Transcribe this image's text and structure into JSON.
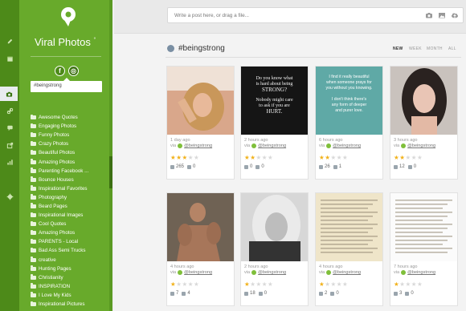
{
  "rail": {
    "icons": [
      "pencil-icon",
      "calendar-icon",
      "chat-icon",
      "camera-icon",
      "link-icon",
      "export-icon",
      "bar-chart-icon",
      "gear-icon"
    ],
    "active_index": 3
  },
  "sidebar": {
    "title": "Viral Photos",
    "title_mark": "°",
    "social": {
      "facebook": "f",
      "instagram": "◎"
    },
    "tag_filter": "#beingstrong",
    "items": [
      "Awesome Quotes",
      "Engaging Photos",
      "Funny Photos",
      "Crazy Photos",
      "Beautiful Photos",
      "Amazing Photos",
      "Parenting Facebook ...",
      "Bounce Houses",
      "Inspirational Favorites",
      "Photography",
      "Beard Pages",
      "Inspirational Images",
      "Cool Quotes",
      "Amazing Photos",
      "PARENTS - Local",
      "Bad Ass Semi Trucks",
      "creative",
      "Hunting Pages",
      "Christianity",
      "INSPIRATION",
      "I Love My Kids",
      "Inspirational Pictures"
    ]
  },
  "topbar": {
    "post_placeholder": "Write a post here, or drag a file..."
  },
  "main": {
    "hashtag": "#beingstrong",
    "ranges": [
      "NEW",
      "WEEK",
      "MONTH",
      "ALL"
    ],
    "via_label": "via",
    "handle": "@beingstrong",
    "cards": [
      {
        "time": "1 day ago",
        "rating": 3,
        "likes": "265",
        "comments": "0",
        "image": "selfie-girl-blonde"
      },
      {
        "time": "2 hours ago",
        "rating": 2,
        "likes": "0",
        "comments": "0",
        "image": "quote-strong-hurt",
        "quote": [
          "Do you know what",
          "is hard about being",
          "STRONG?",
          "Nobody might care",
          "to ask if you are",
          "HURT."
        ]
      },
      {
        "time": "6 hours ago",
        "rating": 2,
        "likes": "26",
        "comments": "1",
        "image": "quote-teal",
        "quote": [
          "I find it really beautiful",
          "when someone prays for",
          "you without you knowing.",
          "I don't think there's",
          "any form of deeper",
          "and purer love."
        ]
      },
      {
        "time": "3 hours ago",
        "rating": 2,
        "likes": "12",
        "comments": "0",
        "image": "portrait-dark-hair"
      },
      {
        "time": "4 hours ago",
        "rating": 1,
        "likes": "7",
        "comments": "4",
        "image": "muscle-man"
      },
      {
        "time": "2 hours ago",
        "rating": 1,
        "likes": "18",
        "comments": "0",
        "image": "bw-woman"
      },
      {
        "time": "4 hours ago",
        "rating": 1,
        "likes": "2",
        "comments": "0",
        "image": "text-beige"
      },
      {
        "time": "7 hours ago",
        "rating": 1,
        "likes": "3",
        "comments": "0",
        "image": "text-white"
      }
    ]
  },
  "colors": {
    "rail": "#4d8a19",
    "sidebar": "#68aa2b",
    "star_on": "#f2b21c",
    "star_off": "#d9d9d9"
  }
}
